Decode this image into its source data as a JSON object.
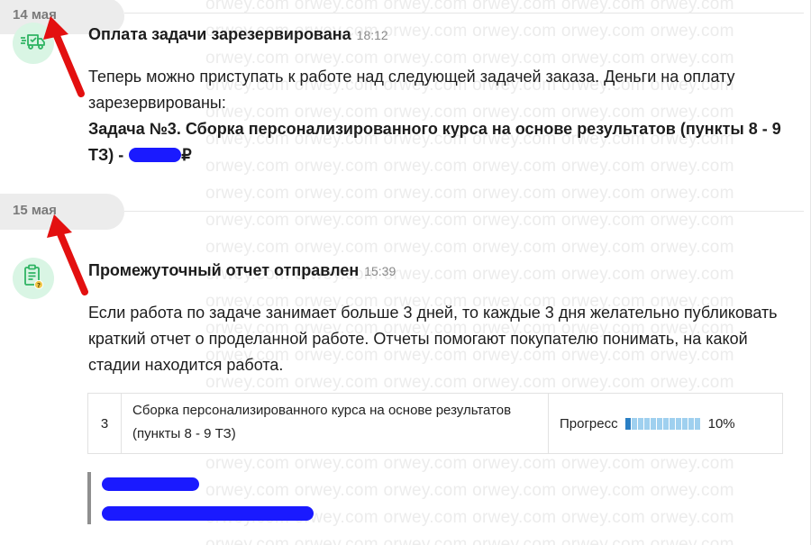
{
  "watermark_text": "orwey.com orwey.com orwey.com orwey.com orwey.com orwey.com",
  "days": [
    {
      "date": "14 мая",
      "message": {
        "title": "Оплата задачи зарезервирована",
        "time": "18:12",
        "text": "Теперь можно приступать к работе над следующей задачей заказа. Деньги на оплату зарезервированы:",
        "task_line": "Задача №3. Сборка персонализированного курса на основе результатов (пункты 8 - 9 ТЗ) -",
        "task_suffix": "₽"
      }
    },
    {
      "date": "15 мая",
      "message": {
        "title": "Промежуточный отчет отправлен",
        "time": "15:39",
        "text": "Если работа по задаче занимает больше 3 дней, то каждые 3 дня желательно публиковать краткий отчет о проделанной работе. Отчеты помогают покупателю понимать, на какой стадии находится работа.",
        "task": {
          "number": "3",
          "name": "Сборка персонализированного курса на основе результатов (пункты 8 - 9 ТЗ)",
          "progress_label": "Прогресс",
          "progress_value": "10%",
          "progress_fraction": 0.1
        }
      }
    }
  ],
  "colors": {
    "avatar_bg": "#d9f5e4",
    "icon_green": "#2fb463",
    "progress_on": "#2a7fc4",
    "progress_off": "#9fd0ef",
    "redaction": "#1a1aff",
    "arrow": "#e31010"
  },
  "icons": {
    "payment_reserved": "truck-money-icon",
    "report_sent": "clipboard-question-icon"
  }
}
